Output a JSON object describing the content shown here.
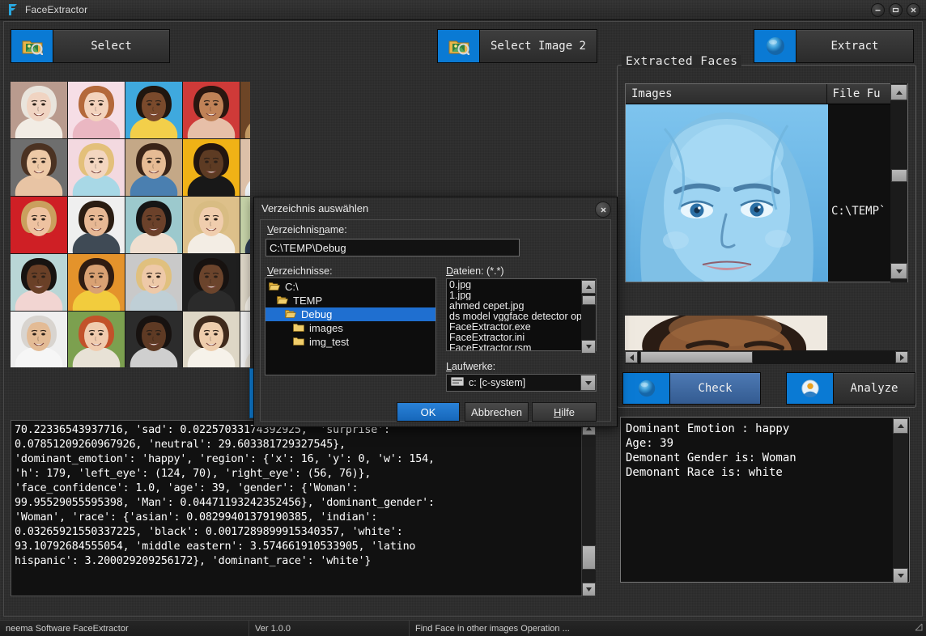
{
  "window": {
    "title": "FaceExtractor",
    "logo_icon": "f-logo-icon",
    "controls": [
      {
        "name": "minimize-button",
        "glyph": "–"
      },
      {
        "name": "maximize-button",
        "glyph": "▭"
      },
      {
        "name": "close-button",
        "glyph": "✕"
      }
    ]
  },
  "toolbar": {
    "select_label": "Select",
    "select_icon": "picture-folder-icon",
    "select_image2_label": "Select Image 2",
    "select_image2_icon": "picture-folder-icon",
    "extract_label": "Extract",
    "extract_icon": "blue-sphere-icon"
  },
  "thumbnails": {
    "columns": 5,
    "rows": 5,
    "items": [
      {
        "alt": "elderly blonde woman smiling",
        "bg": "#b99b8e",
        "skin": "#f0d4c2",
        "hair": "#e9e4dc",
        "shirt": "#f2ece4"
      },
      {
        "alt": "young woman pink top",
        "bg": "#f6dee6",
        "skin": "#f3d3bd",
        "hair": "#b4693b",
        "shirt": "#eab7c2"
      },
      {
        "alt": "woman afro hair blue background",
        "bg": "#3fa9de",
        "skin": "#7a4a2c",
        "hair": "#20160f",
        "shirt": "#f3cf4a"
      },
      {
        "alt": "woman curly hair red background",
        "bg": "#cf3a38",
        "skin": "#c08257",
        "hair": "#2a1710",
        "shirt": "#e7bfa8"
      },
      {
        "alt": "man hand on face brown background",
        "bg": "#6d4526",
        "skin": "#5d3a21",
        "hair": "#140d08",
        "shirt": "#c09761"
      },
      {
        "alt": "person with flower crown",
        "bg": "#6e6e6e",
        "skin": "#edc9a6",
        "hair": "#4b3222",
        "shirt": "#e8c4a4"
      },
      {
        "alt": "blonde girl hands on cheeks pink",
        "bg": "#f3d9e0",
        "skin": "#f3d6c0",
        "hair": "#e3c07a",
        "shirt": "#a8d8e6"
      },
      {
        "alt": "woman denim shirt laughing",
        "bg": "#c4a887",
        "skin": "#e6bb94",
        "hair": "#3a2418",
        "shirt": "#4a7fb0"
      },
      {
        "alt": "woman headband yellow background",
        "bg": "#f0b216",
        "skin": "#5d3b23",
        "hair": "#221510",
        "shirt": "#181818"
      },
      {
        "alt": "boy hand on chin beige",
        "bg": "#dcc0a8",
        "skin": "#f0cdae",
        "hair": "#d0a05e",
        "shirt": "#e9eef2"
      },
      {
        "alt": "woman red sunglasses red background",
        "bg": "#cf1f25",
        "skin": "#eec2a0",
        "hair": "#caa05e",
        "shirt": "#cf1f25"
      },
      {
        "alt": "man smiling white background",
        "bg": "#efefef",
        "skin": "#e7b894",
        "hair": "#2a1c12",
        "shirt": "#3f4a55"
      },
      {
        "alt": "man black hat teal background",
        "bg": "#9cc9cd",
        "skin": "#6b412a",
        "hair": "#151515",
        "shirt": "#f0dfd0"
      },
      {
        "alt": "blonde woman yellow background",
        "bg": "#ddc08a",
        "skin": "#f0cdad",
        "hair": "#d8bc83",
        "shirt": "#f3ede4"
      },
      {
        "alt": "woman hand on chin green background",
        "bg": "#c6d3a8",
        "skin": "#e8c09a",
        "hair": "#241a12",
        "shirt": "#2f3f55"
      },
      {
        "alt": "dark skin man pink background",
        "bg": "#b9d6d6",
        "skin": "#6a4027",
        "hair": "#171311",
        "shirt": "#f2d5d2"
      },
      {
        "alt": "woman yellow top orange background",
        "bg": "#e4932b",
        "skin": "#d9a173",
        "hair": "#2f1c12",
        "shirt": "#f2cc3d"
      },
      {
        "alt": "blonde woman grey background",
        "bg": "#c9c9c9",
        "skin": "#eec9a8",
        "hair": "#e0c07e",
        "shirt": "#bfcfd6"
      },
      {
        "alt": "man beard dark background",
        "bg": "#1f1f1f",
        "skin": "#6b442c",
        "hair": "#171210",
        "shirt": "#2b2b2b"
      },
      {
        "alt": "woman white shirt beige background",
        "bg": "#dcd5c6",
        "skin": "#efcfae",
        "hair": "#3a271a",
        "shirt": "#f4f0e8"
      },
      {
        "alt": "elderly man arms crossed white",
        "bg": "#efefef",
        "skin": "#e3bb95",
        "hair": "#d8d4cf",
        "shirt": "#f6f6f6"
      },
      {
        "alt": "red hair woman green background",
        "bg": "#7ca04f",
        "skin": "#f0cbae",
        "hair": "#c2522a",
        "shirt": "#e8e2d6"
      },
      {
        "alt": "man checkered shirt dark background",
        "bg": "#2c2c2c",
        "skin": "#5e3a24",
        "hair": "#171210",
        "shirt": "#cfcfcf"
      },
      {
        "alt": "woman white top beige background",
        "bg": "#ded7c6",
        "skin": "#eecdac",
        "hair": "#3f2a1c",
        "shirt": "#f6f2ea"
      },
      {
        "alt": "woman hands clasped white background",
        "bg": "#ececec",
        "skin": "#edcba9",
        "hair": "#2e2018",
        "shirt": "#e4dfd6"
      }
    ]
  },
  "grid_scrollbar": {
    "name": "thumbnail-scrollbar"
  },
  "output_text": "70.22336543937716, 'sad': 0.02257033174392925,  'surprise':\n0.07851209260967926, 'neutral': 29.603381729327545},\n'dominant_emotion': 'happy', 'region': {'x': 16, 'y': 0, 'w': 154,\n'h': 179, 'left_eye': (124, 70), 'right_eye': (56, 76)},\n'face_confidence': 1.0, 'age': 39, 'gender': {'Woman':\n99.95529055595398, 'Man': 0.04471193242352456}, 'dominant_gender':\n'Woman', 'race': {'asian': 0.08299401379190385, 'indian':\n0.03265921550337225, 'black': 0.0017289899915340357, 'white':\n93.10792684555054, 'middle eastern': 3.574661910533905, 'latino\nhispanic': 3.200029209256172}, 'dominant_race': 'white'}",
  "faces_panel": {
    "legend": "Extracted Faces",
    "columns": [
      {
        "label": "Images"
      },
      {
        "label": "File Fu"
      }
    ],
    "row_path": "C:\\TEMP`",
    "check_label": "Check",
    "check_icon": "blue-sphere-icon",
    "analyze_label": "Analyze",
    "analyze_icon": "person-badge-icon",
    "result_text": "Dominant Emotion : happy\nAge: 39\nDemonant Gender is: Woman\nDemonant Race is: white"
  },
  "dialog": {
    "title": "Verzeichnis auswählen",
    "close_glyph": "✕",
    "dirname_label": "Verzeichnisname:",
    "dirname_value": "C:\\TEMP\\Debug",
    "directories_label": "Verzeichnisse:",
    "directories": [
      {
        "label": "C:\\",
        "depth": 0,
        "selected": false
      },
      {
        "label": "TEMP",
        "depth": 1,
        "selected": false
      },
      {
        "label": "Debug",
        "depth": 2,
        "selected": true
      },
      {
        "label": "images",
        "depth": 3,
        "selected": false
      },
      {
        "label": "img_test",
        "depth": 3,
        "selected": false
      }
    ],
    "files_label": "Dateien: (*.*)",
    "files": [
      "0.jpg",
      "1.jpg",
      "ahmed cepet.jpg",
      "ds model vggface detector op",
      "FaceExtractor.exe",
      "FaceExtractor.ini",
      "FaceExtractor.rsm"
    ],
    "drives_label": "Laufwerke:",
    "drives_value": "c: [c-system]",
    "drives_icon": "drive-icon",
    "ok_label": "OK",
    "cancel_label": "Abbrechen",
    "help_label": "Hilfe"
  },
  "statusbar": {
    "app": "neema Software FaceExtractor",
    "version": "Ver 1.0.0",
    "message": "Find Face in other images Operation ..."
  },
  "colors": {
    "accent": "#0a7ad4",
    "selection": "#1f6fd0",
    "window_bg": "#2a2a2a",
    "text": "#e6e6e6"
  }
}
